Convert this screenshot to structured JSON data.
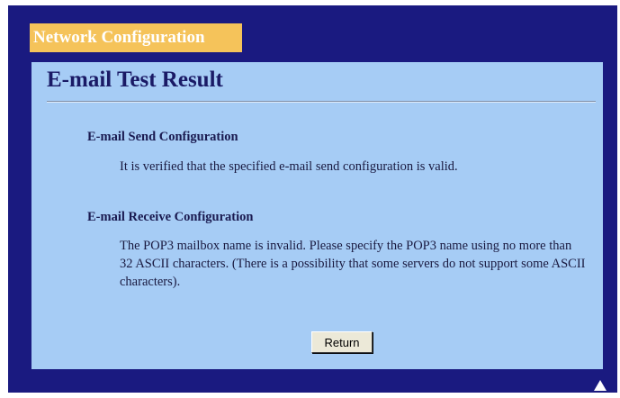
{
  "header": {
    "tab_label": "Network Configuration"
  },
  "page": {
    "title": "E-mail Test Result"
  },
  "sections": [
    {
      "heading": "E-mail Send Configuration",
      "body": "It is verified that the specified e-mail send configuration is valid."
    },
    {
      "heading": "E-mail Receive Configuration",
      "body": "The POP3 mailbox name is invalid. Please specify the POP3 name using no more than 32 ASCII characters. (There is a possibility that some servers do not support some ASCII characters)."
    }
  ],
  "actions": {
    "return_label": "Return"
  },
  "icons": {
    "scroll_top": "up-arrow-icon"
  },
  "colors": {
    "frame_background": "#1a1a80",
    "tab_background": "#f5c35a",
    "panel_background": "#a6ccf5",
    "title_text": "#1a1a66"
  }
}
